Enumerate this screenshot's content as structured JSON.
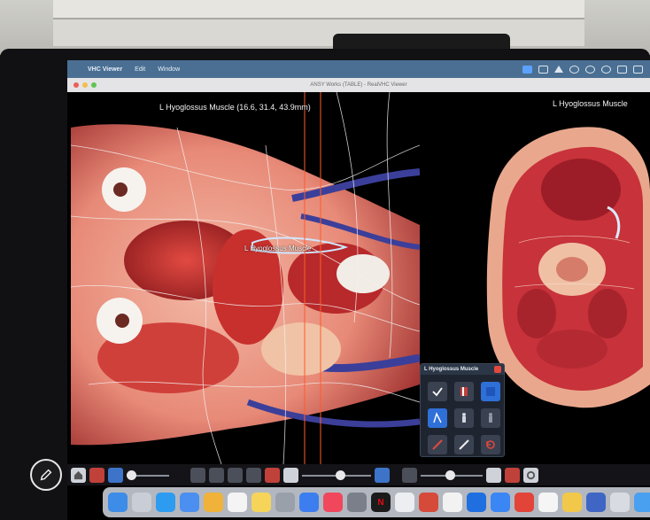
{
  "menubar": {
    "apple_symbol": "",
    "app_name": "VHC Viewer",
    "items": [
      "Edit",
      "Window"
    ]
  },
  "window": {
    "title": "ANSY Works (TABLE) - RealVHC Viewer"
  },
  "viewport_3d": {
    "title": "L Hyoglossus Muscle (16.6, 31.4, 43.9mm)",
    "overlay_label": "L Hyoglossus Muscle"
  },
  "viewport_slice": {
    "title": "L Hyoglossus Muscle"
  },
  "popup": {
    "title": "L Hyoglossus Muscle"
  },
  "dock": {
    "netflix_letter": "N"
  },
  "colors": {
    "menubar": "#4a6f93",
    "accent_blue": "#2f6fd8",
    "cursor_line": "#ff5a2a"
  }
}
